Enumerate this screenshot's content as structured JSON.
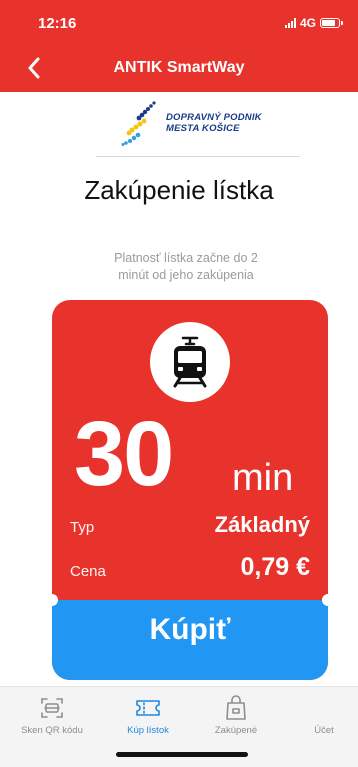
{
  "status_bar": {
    "time": "12:16",
    "network": "4G"
  },
  "nav": {
    "title": "ANTIK SmartWay"
  },
  "logo": {
    "line1": "DOPRAVNÝ PODNIK",
    "line2": "MESTA KOŠICE"
  },
  "page": {
    "title": "Zakúpenie lístka",
    "validity_line1": "Platnosť lístka začne do 2",
    "validity_line2": "minút od jeho zakúpenia"
  },
  "ticket": {
    "duration_value": "30",
    "duration_unit": "min",
    "type_label": "Typ",
    "type_value": "Základný",
    "price_label": "Cena",
    "price_value": "0,79 €",
    "buy_label": "Kúpiť"
  },
  "tabs": [
    {
      "label": "Sken QR kódu",
      "icon": "qr-scan-icon",
      "active": false
    },
    {
      "label": "Kúp lístok",
      "icon": "ticket-icon",
      "active": true
    },
    {
      "label": "Zakúpené",
      "icon": "shopping-bag-icon",
      "active": false
    },
    {
      "label": "Účet",
      "icon": "account-icon",
      "active": false
    }
  ],
  "colors": {
    "brand_red": "#e8332c",
    "buy_blue": "#2196f3",
    "active_tab": "#1e88e5",
    "inactive_tab": "#8e8e8e"
  }
}
